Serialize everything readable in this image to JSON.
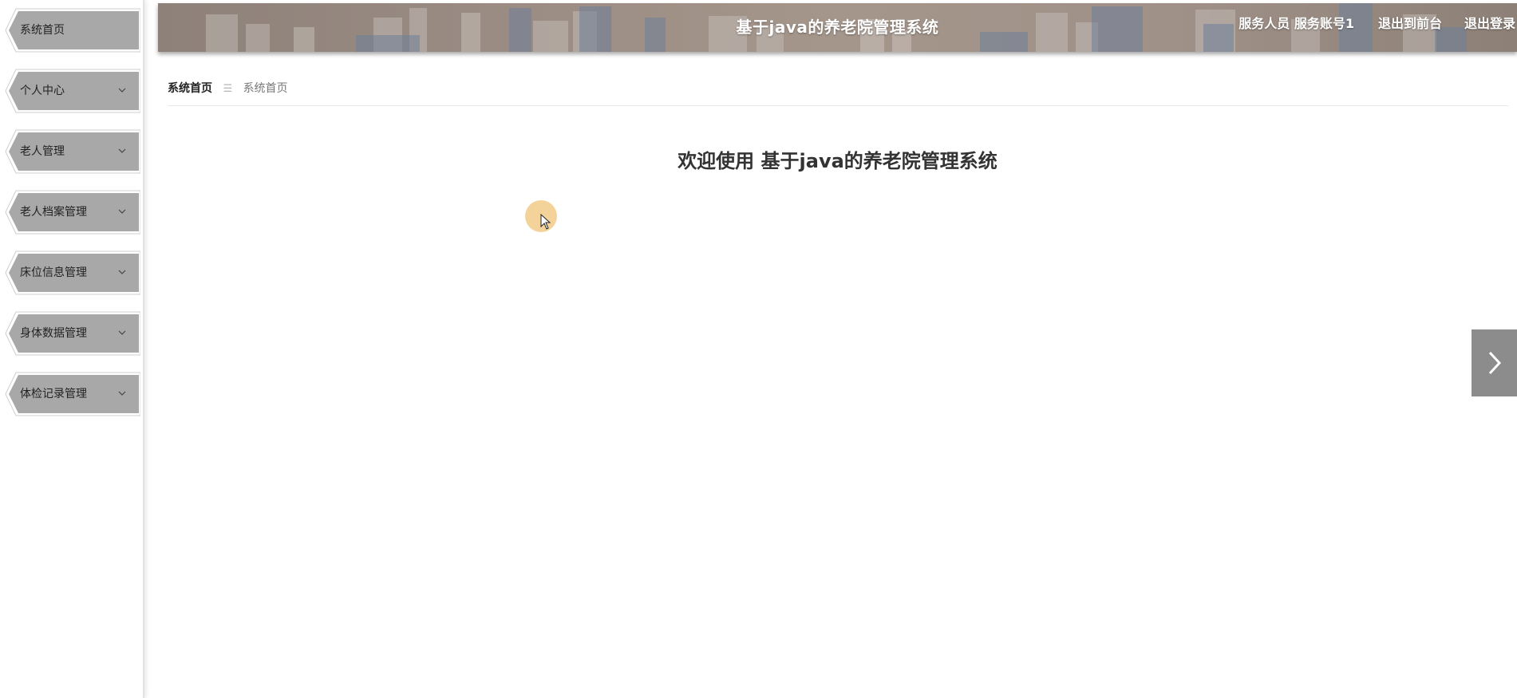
{
  "sidebar": {
    "items": [
      {
        "label": "系统首页",
        "has_submenu": false
      },
      {
        "label": "个人中心",
        "has_submenu": true
      },
      {
        "label": "老人管理",
        "has_submenu": true
      },
      {
        "label": "老人档案管理",
        "has_submenu": true
      },
      {
        "label": "床位信息管理",
        "has_submenu": true
      },
      {
        "label": "身体数据管理",
        "has_submenu": true
      },
      {
        "label": "体检记录管理",
        "has_submenu": true
      }
    ]
  },
  "header": {
    "title": "基于java的养老院管理系统",
    "user_info": "服务人员 服务账号1",
    "front_link": "退出到前台",
    "logout_link": "退出登录"
  },
  "breadcrumb": {
    "home": "系统首页",
    "separator_icon": "menu-lines-icon",
    "current": "系统首页"
  },
  "main": {
    "welcome": "欢迎使用 基于java的养老院管理系统"
  },
  "icons": {
    "menu_chevron": "chevron-down-icon",
    "side_arrow": "chevron-right-icon"
  },
  "colors": {
    "menu_fill": "#a8a8a8",
    "header_bg": "#9a8c83",
    "side_arrow_bg": "#8c8c8c",
    "text_dark": "#333333"
  }
}
